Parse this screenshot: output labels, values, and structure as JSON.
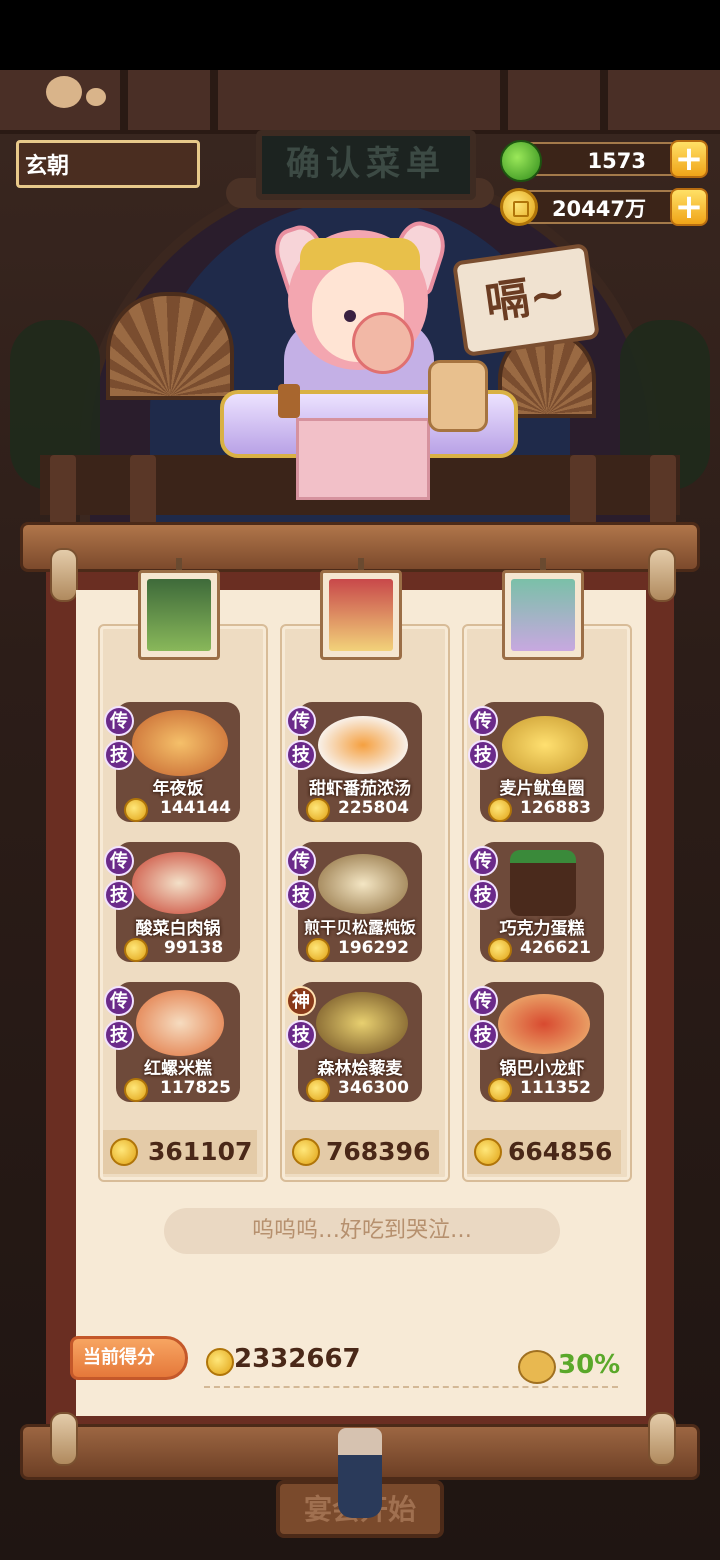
{
  "header": {
    "player_name": "玄朝",
    "sign_title": "确认菜单",
    "jade_amount": "1573",
    "coin_amount": "20447万",
    "plus_label": "+"
  },
  "character": {
    "speech": "嗝~"
  },
  "columns": [
    {
      "total": "361107",
      "dishes": [
        {
          "badge_top": "传",
          "badge_bottom": "技",
          "name": "年夜饭",
          "price": "144144"
        },
        {
          "badge_top": "传",
          "badge_bottom": "技",
          "name": "酸菜白肉锅",
          "price": "99138"
        },
        {
          "badge_top": "传",
          "badge_bottom": "技",
          "name": "红螺米糕",
          "price": "117825"
        }
      ]
    },
    {
      "total": "768396",
      "dishes": [
        {
          "badge_top": "传",
          "badge_bottom": "技",
          "name": "甜虾番茄浓汤",
          "price": "225804"
        },
        {
          "badge_top": "传",
          "badge_bottom": "技",
          "name": "煎干贝松露炖饭",
          "price": "196292"
        },
        {
          "badge_top": "神",
          "badge_bottom": "技",
          "name": "森林烩藜麦",
          "price": "346300"
        }
      ]
    },
    {
      "total": "664856",
      "dishes": [
        {
          "badge_top": "传",
          "badge_bottom": "技",
          "name": "麦片鱿鱼圈",
          "price": "126883"
        },
        {
          "badge_top": "传",
          "badge_bottom": "技",
          "name": "巧克力蛋糕",
          "price": "426621"
        },
        {
          "badge_top": "传",
          "badge_bottom": "技",
          "name": "锅巴小龙虾",
          "price": "111352"
        }
      ]
    }
  ],
  "comment": "呜呜呜…好吃到哭泣…",
  "score": {
    "label": "当前得分",
    "value": "2332667",
    "bonus_percent": "30%"
  },
  "start_button": "宴会开始",
  "colors": {
    "board": "#f7ead6",
    "frame": "#6a2e22",
    "accent_green": "#5aa82a",
    "badge_purple": "#6b2a8a"
  }
}
